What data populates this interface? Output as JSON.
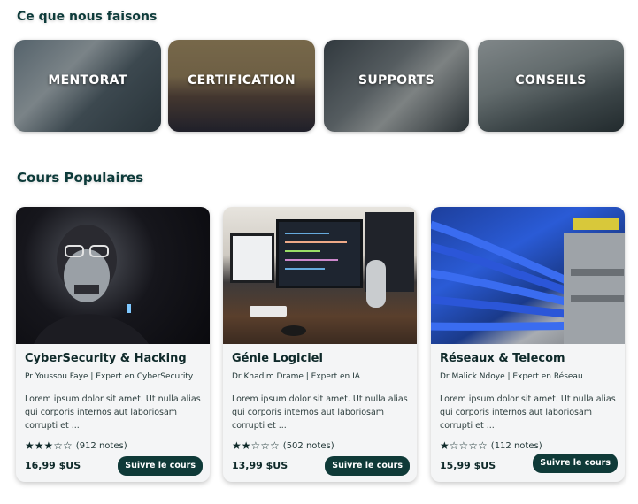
{
  "sections": {
    "services_title": "Ce que nous faisons",
    "courses_title": "Cours Populaires"
  },
  "services": [
    {
      "label": "MENTORAT"
    },
    {
      "label": "CERTIFICATION"
    },
    {
      "label": "SUPPORTS"
    },
    {
      "label": "CONSEILS"
    }
  ],
  "courses": [
    {
      "title": "CyberSecurity & Hacking",
      "author": "Pr Youssou Faye | Expert en CyberSecurity",
      "description": "Lorem ipsum dolor sit amet. Ut nulla alias qui corporis internos aut laboriosam corrupti et ...",
      "stars": "★★★☆☆",
      "rating": 3,
      "notes": "(912 notes)",
      "price": "16,99 $US",
      "button": "Suivre  le cours"
    },
    {
      "title": "Génie Logiciel",
      "author": "Dr Khadim Drame | Expert en IA",
      "description": "Lorem ipsum dolor sit amet. Ut nulla alias qui corporis internos aut laboriosam corrupti et ...",
      "stars": "★★☆☆☆",
      "rating": 2,
      "notes": "(502 notes)",
      "price": "13,99 $US",
      "button": "Suivre  le cours"
    },
    {
      "title": "Réseaux & Telecom",
      "author": "Dr Malick Ndoye | Expert en Réseau",
      "description": "Lorem ipsum dolor sit amet. Ut nulla alias qui corporis internos aut laboriosam corrupti et ...",
      "stars": "★☆☆☆☆",
      "rating": 1,
      "notes": "(112 notes)",
      "price": "15,99 $US",
      "button": "Suivre  le cours"
    }
  ],
  "colors": {
    "accent": "#0f3a38",
    "heading": "#0d3b3a",
    "card_bg": "#f4f5f6"
  }
}
